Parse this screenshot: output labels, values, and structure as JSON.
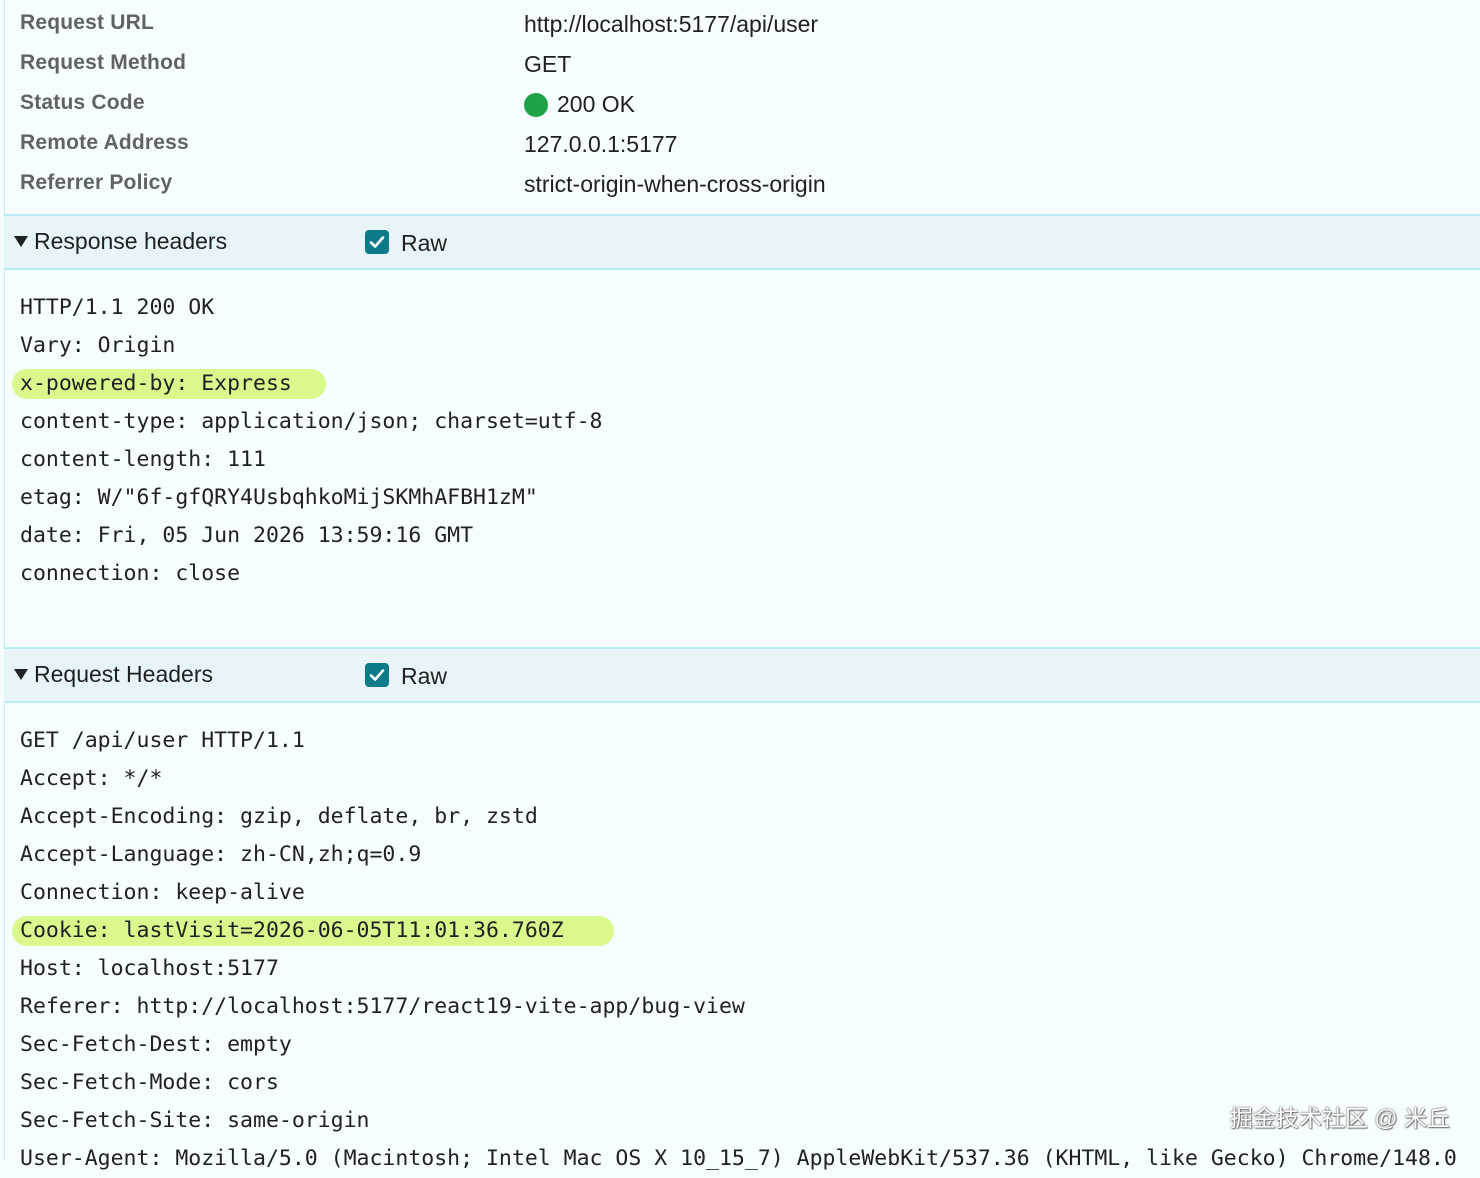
{
  "general": {
    "rows": [
      {
        "key": "Request URL",
        "value": "http://localhost:5177/api/user"
      },
      {
        "key": "Request Method",
        "value": "GET"
      },
      {
        "key": "Status Code",
        "value": "200 OK"
      },
      {
        "key": "Remote Address",
        "value": "127.0.0.1:5177"
      },
      {
        "key": "Referrer Policy",
        "value": "strict-origin-when-cross-origin"
      }
    ],
    "status_color": "#1ea446"
  },
  "response_headers": {
    "title": "Response headers",
    "raw_label": "Raw",
    "raw_checked": true,
    "lines": [
      "HTTP/1.1 200 OK",
      "Vary: Origin",
      "x-powered-by: Express",
      "content-type: application/json; charset=utf-8",
      "content-length: 111",
      "etag: W/\"6f-gfQRY4UsbqhkoMijSKMhAFBH1zM\"",
      "date: Fri, 05 Jun 2026 13:59:16 GMT",
      "connection: close"
    ],
    "highlighted_line": "x-powered-by: Express"
  },
  "request_headers": {
    "title": "Request Headers",
    "raw_label": "Raw",
    "raw_checked": true,
    "lines": [
      "GET /api/user HTTP/1.1",
      "Accept: */*",
      "Accept-Encoding: gzip, deflate, br, zstd",
      "Accept-Language: zh-CN,zh;q=0.9",
      "Connection: keep-alive",
      "Cookie: lastVisit=2026-06-05T11:01:36.760Z",
      "Host: localhost:5177",
      "Referer: http://localhost:5177/react19-vite-app/bug-view",
      "Sec-Fetch-Dest: empty",
      "Sec-Fetch-Mode: cors",
      "Sec-Fetch-Site: same-origin",
      "User-Agent: Mozilla/5.0 (Macintosh; Intel Mac OS X 10_15_7) AppleWebKit/537.36 (KHTML, like Gecko) Chrome/148.0"
    ],
    "highlighted_line": "Cookie: lastVisit=2026-06-05T11:01:36.760Z"
  },
  "highlight_color": "#d9f98c",
  "accent_color": "#0b7a89",
  "watermark": "掘金技术社区 @ 米丘"
}
